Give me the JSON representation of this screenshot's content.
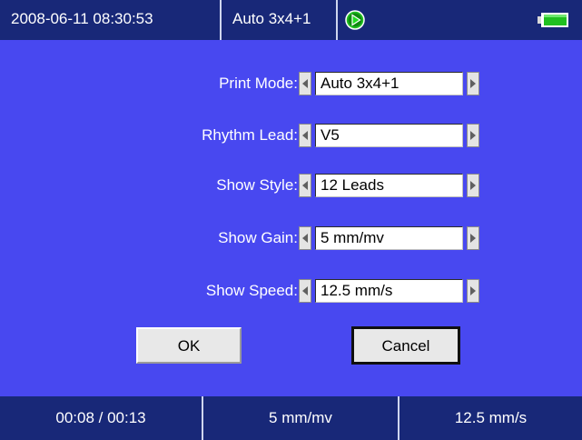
{
  "status_bar": {
    "datetime": "2008-06-11 08:30:53",
    "mode": "Auto 3x4+1",
    "play_icon": "play-circle-icon",
    "battery_icon": "battery-icon",
    "colors": {
      "bar": "#182878",
      "play": "#22c022",
      "battery": "#20c020"
    }
  },
  "dialog": {
    "background": "#4848f0",
    "fields": [
      {
        "label": "Print Mode:",
        "value": "Auto 3x4+1"
      },
      {
        "label": "Rhythm Lead:",
        "value": "V5"
      },
      {
        "label": "Show Style:",
        "value": "12 Leads"
      },
      {
        "label": "Show Gain:",
        "value": "5 mm/mv"
      },
      {
        "label": "Show Speed:",
        "value": "12.5 mm/s"
      }
    ],
    "ok_label": "OK",
    "cancel_label": "Cancel"
  },
  "footer": {
    "time": "00:08 / 00:13",
    "gain": "5 mm/mv",
    "speed": "12.5 mm/s"
  }
}
